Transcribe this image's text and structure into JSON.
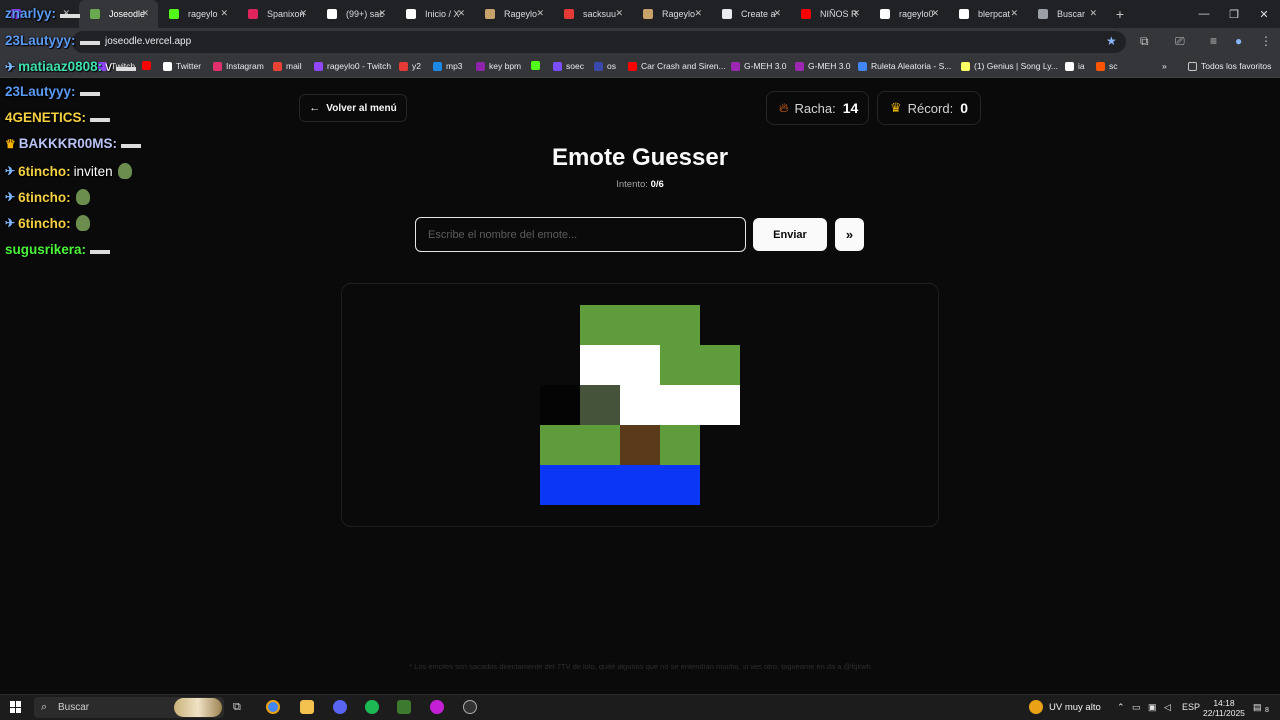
{
  "browser": {
    "tabs": [
      {
        "label": "",
        "icon": "twitch-icon",
        "color": "#9146ff",
        "active": false
      },
      {
        "label": "Joseodle",
        "icon": "joseodle-favicon-icon",
        "color": "#6aa84f",
        "active": true
      },
      {
        "label": "rageylo",
        "icon": "kick-icon",
        "color": "#53fc18",
        "active": false
      },
      {
        "label": "Spanixon",
        "icon": "app-icon",
        "color": "#e0245e",
        "active": false
      },
      {
        "label": "(99+) sac",
        "icon": "tiktok-icon",
        "color": "#ffffff",
        "active": false
      },
      {
        "label": "Inicio / X",
        "icon": "x-icon",
        "color": "#ffffff",
        "active": false
      },
      {
        "label": "Rageylo",
        "icon": "rageylo-icon",
        "color": "#c9a26b",
        "active": false
      },
      {
        "label": "sacksuu",
        "icon": "app-icon",
        "color": "#e53935",
        "active": false
      },
      {
        "label": "Rageylo",
        "icon": "rageylo-icon",
        "color": "#c9a26b",
        "active": false
      },
      {
        "label": "Create a",
        "icon": "doc-icon",
        "color": "#e8eaed",
        "active": false
      },
      {
        "label": "NIÑOS R",
        "icon": "youtube-icon",
        "color": "#ff0000",
        "active": false
      },
      {
        "label": "rageylo0",
        "icon": "7tv-icon",
        "color": "#ffffff",
        "active": false
      },
      {
        "label": "blerpcat",
        "icon": "7tv-icon",
        "color": "#ffffff",
        "active": false
      },
      {
        "label": "Buscar",
        "icon": "search-tab-icon",
        "color": "#9aa0a6",
        "active": false
      }
    ],
    "url": "joseodle.vercel.app",
    "bookmarks": [
      {
        "label": "Twitch",
        "color": "#9146ff"
      },
      {
        "label": "",
        "color": "#ff0000"
      },
      {
        "label": "Twitter",
        "color": "#ffffff"
      },
      {
        "label": "Instagram",
        "color": "#e1306c"
      },
      {
        "label": "mail",
        "color": "#ea4335"
      },
      {
        "label": "rageylo0 - Twitch",
        "color": "#9146ff"
      },
      {
        "label": "y2",
        "color": "#e53935"
      },
      {
        "label": "mp3",
        "color": "#1e88e5"
      },
      {
        "label": "key bpm",
        "color": "#8e24aa"
      },
      {
        "label": "",
        "color": "#53fc18"
      },
      {
        "label": "soec",
        "color": "#7c4dff"
      },
      {
        "label": "os",
        "color": "#3949ab"
      },
      {
        "label": "Car Crash and Siren...",
        "color": "#ff0000"
      },
      {
        "label": "G-MEH 3.0",
        "color": "#9c27b0"
      },
      {
        "label": "G-MEH 3.0",
        "color": "#9c27b0"
      },
      {
        "label": "Ruleta Aleatoria - S...",
        "color": "#4285f4"
      },
      {
        "label": "(1) Genius | Song Ly...",
        "color": "#ffff64"
      },
      {
        "label": "ia",
        "color": "#ffffff"
      },
      {
        "label": "sc",
        "color": "#ff5500"
      }
    ],
    "all_bookmarks_label": "Todos los favoritos"
  },
  "chat": [
    {
      "user": "znarlyy",
      "color": "#5b9bf5",
      "msg": "",
      "badge": ""
    },
    {
      "user": "23Lautyyy",
      "color": "#5b9bf5",
      "msg": "",
      "badge": ""
    },
    {
      "user": "matiaaz0808",
      "color": "#3fe0b0",
      "msg": "v",
      "badge": "✈"
    },
    {
      "user": "23Lautyyy",
      "color": "#5b9bf5",
      "msg": "",
      "badge": ""
    },
    {
      "user": "4GENETICS",
      "color": "#f5d142",
      "msg": "",
      "badge": ""
    },
    {
      "user": "BAKKKR00MS",
      "color": "#b9c3f5",
      "msg": "",
      "badge": "♛"
    },
    {
      "user": "6tincho",
      "color": "#f5d142",
      "msg": "inviten",
      "badge": "✈"
    },
    {
      "user": "6tincho",
      "color": "#f5d142",
      "msg": "",
      "badge": "✈"
    },
    {
      "user": "6tincho",
      "color": "#f5d142",
      "msg": "",
      "badge": "✈"
    },
    {
      "user": "sugusrikera",
      "color": "#4cf53c",
      "msg": "",
      "badge": ""
    }
  ],
  "page": {
    "back_label": "Volver al menú",
    "streak_label": "Racha:",
    "streak_value": "14",
    "record_label": "Récord:",
    "record_value": "0",
    "title": "Emote Guesser",
    "attempt_label": "Intento:",
    "attempt_value": "0/6",
    "input_placeholder": "Escribe el nombre del emote...",
    "send_label": "Enviar",
    "skip_label": "»",
    "footnote": "* Los emotes son sacados directamente del 7TV de lolo, quité algunos que no se entendían mucho, si ves otro, tagueame en da a @fqkwh"
  },
  "emote_pixels": {
    "grid": [
      [
        "#0a0a0a",
        "#5e9c3c",
        "#5e9c3c",
        "#5e9c3c",
        "#0a0a0a"
      ],
      [
        "#0a0a0a",
        "#ffffff",
        "#ffffff",
        "#5e9c3c",
        "#5e9c3c"
      ],
      [
        "#040404",
        "#44533a",
        "#ffffff",
        "#ffffff",
        "#ffffff"
      ],
      [
        "#5e9c3c",
        "#5e9c3c",
        "#5b3a1b",
        "#5e9c3c",
        "#0a0a0a"
      ],
      [
        "#0b36f5",
        "#0b36f5",
        "#0b36f5",
        "#0b36f5",
        "#0a0a0a"
      ]
    ]
  },
  "taskbar": {
    "search_label": "Buscar",
    "uv_label": "UV muy alto",
    "lang": "ESP",
    "time": "14:18",
    "date": "22/11/2025",
    "notifications": "8"
  }
}
